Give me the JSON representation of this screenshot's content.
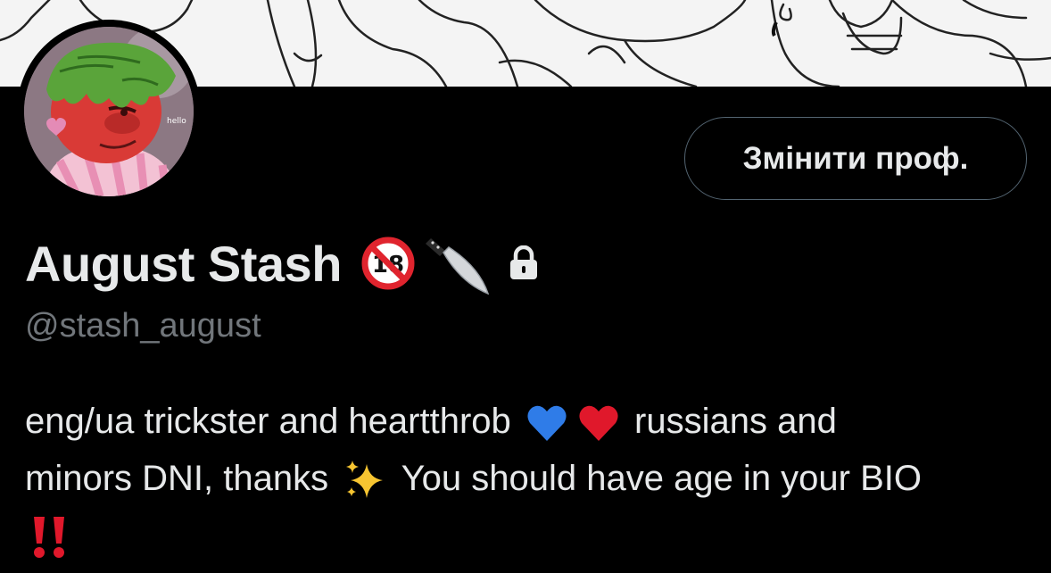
{
  "profile": {
    "display_name": "August Stash",
    "handle": "@stash_august",
    "name_badges": [
      "no-under-18-icon",
      "knife-icon",
      "lock-icon"
    ],
    "edit_button_label": "Змінити проф.",
    "bio": {
      "line1_a": "eng/ua trickster and heartthrob",
      "line1_b": "russians and",
      "line2_a": "minors DNI, thanks",
      "line2_b": "You should have age in your BIO",
      "emojis": [
        "blue-heart-icon",
        "red-heart-icon",
        "sparkles-icon",
        "double-exclamation-icon"
      ]
    }
  },
  "colors": {
    "background": "#000000",
    "text_primary": "#e7e9ea",
    "text_secondary": "#71767b",
    "button_border": "#536471",
    "banner": "#f4f4f4"
  }
}
